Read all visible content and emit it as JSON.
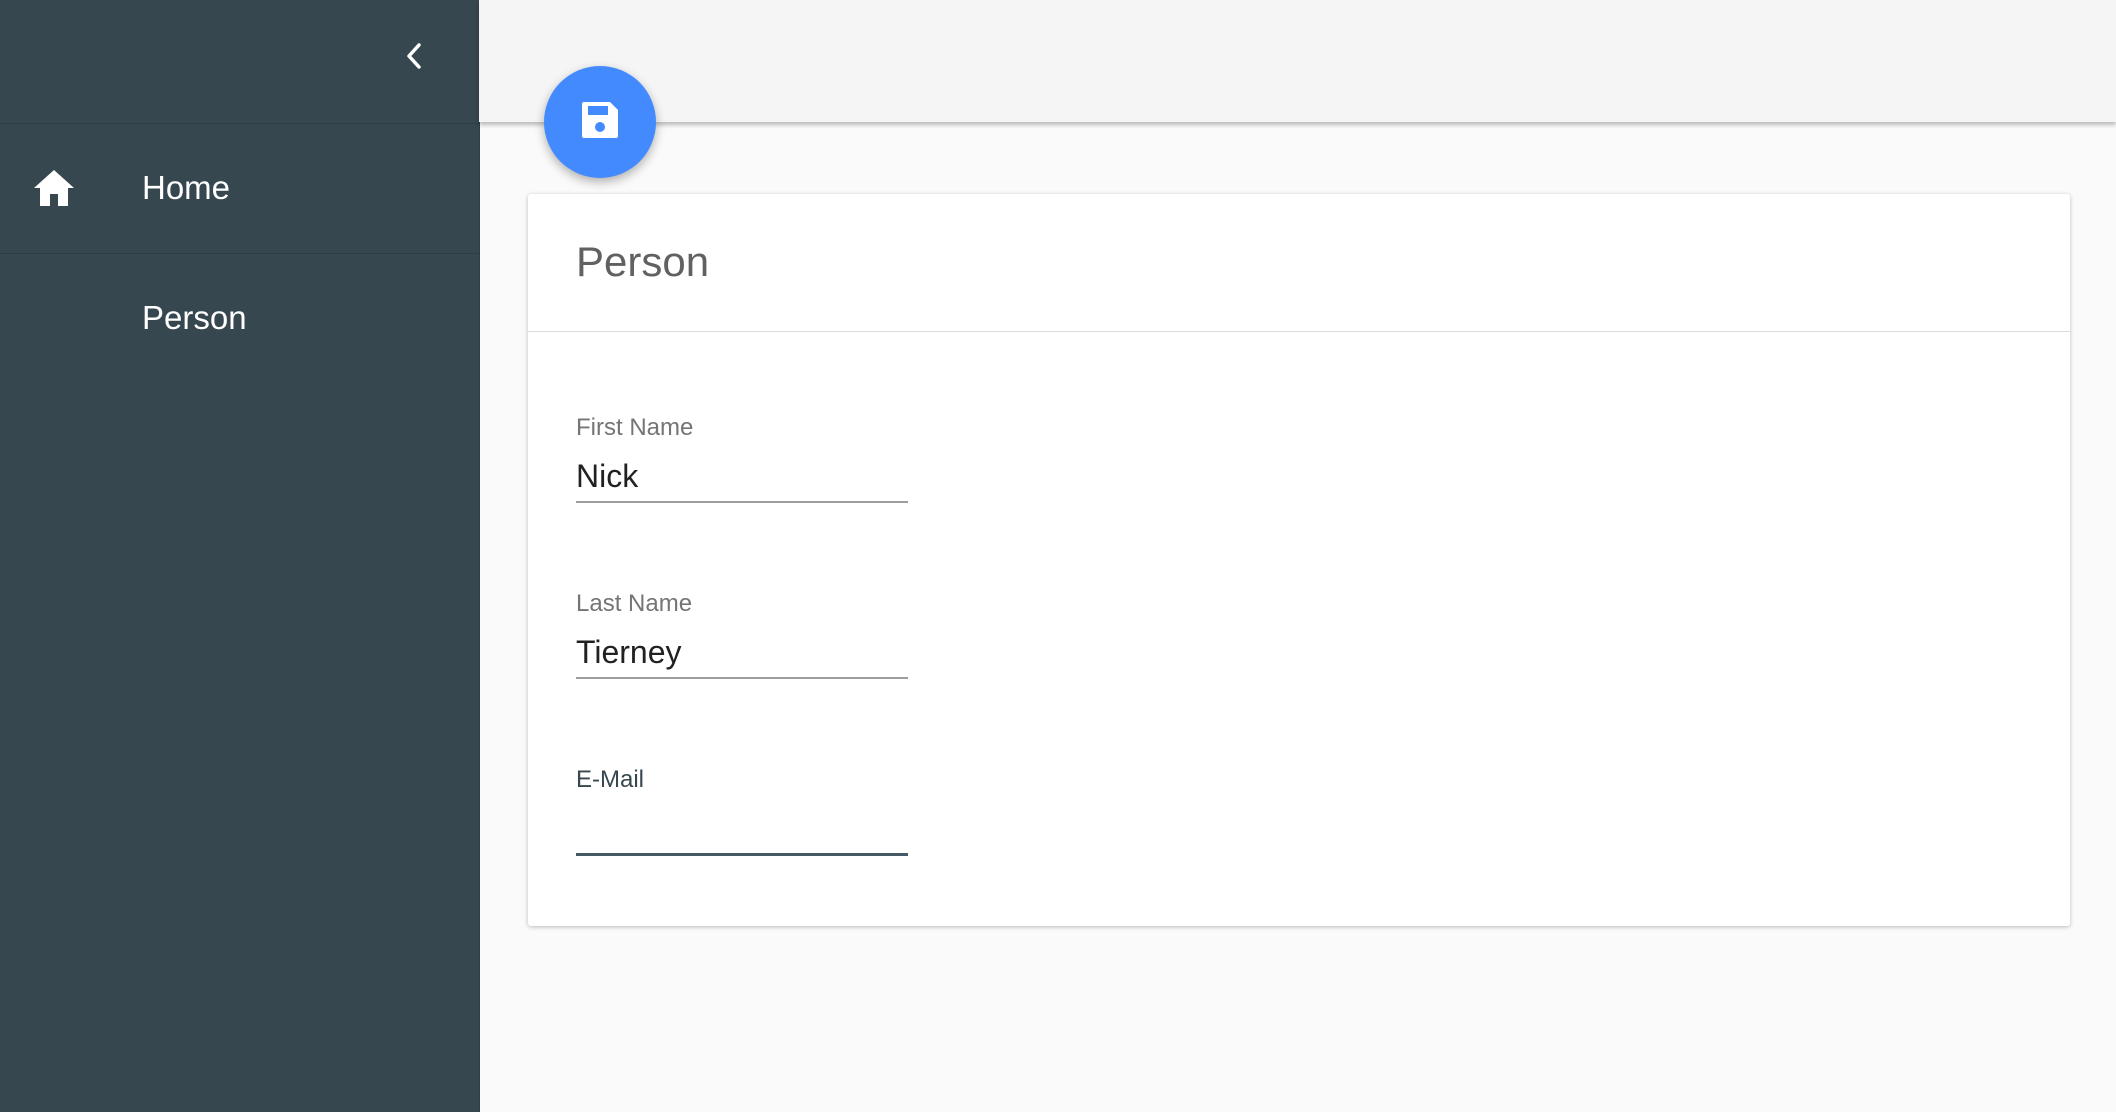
{
  "sidebar": {
    "background_color": "#37474f",
    "collapse_icon": "chevron-left-icon",
    "items": [
      {
        "label": "Home",
        "icon": "home-icon"
      },
      {
        "label": "Person",
        "icon": ""
      }
    ]
  },
  "toolbar": {
    "save_icon": "floppy-disk-icon",
    "fab_color": "#448aff"
  },
  "card": {
    "title": "Person",
    "fields": [
      {
        "label": "First Name",
        "value": "Nick",
        "placeholder": ""
      },
      {
        "label": "Last Name",
        "value": "Tierney",
        "placeholder": ""
      },
      {
        "label": "E-Mail",
        "value": "",
        "placeholder": ""
      }
    ]
  }
}
